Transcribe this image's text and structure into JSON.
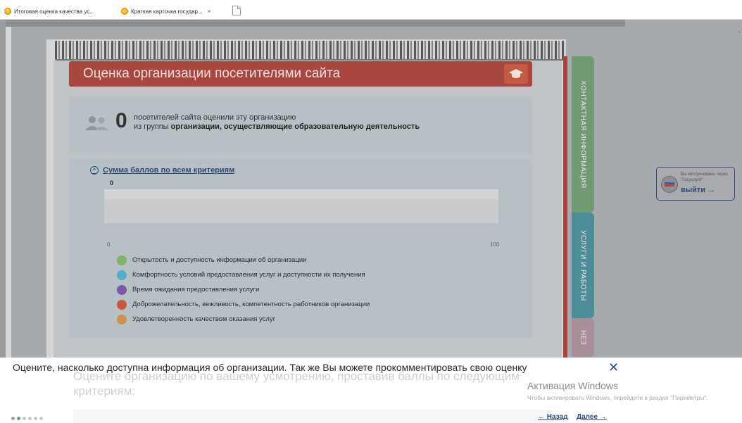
{
  "browser": {
    "tabs": [
      {
        "title": "Итоговая оценка качества ус...",
        "active": false
      },
      {
        "title": "Краткая карточка государ...",
        "active": true,
        "close": "×"
      }
    ]
  },
  "rating": {
    "title": "Оценка организации посетителями сайта",
    "visitor_count": "0",
    "visitor_line1": "посетителей сайта оценили эту организацию",
    "visitor_line2_prefix": "из группы ",
    "visitor_line2_group": "организации, осуществляющие образовательную деятельность",
    "sum_toggle": "Сумма баллов по всем критериям",
    "bar_value": "0",
    "bar_value_fraction": 0,
    "axis_min": "0",
    "axis_max": "100",
    "legend": [
      {
        "label": "Открытость и доступность информации об организации",
        "color": "#7db36a"
      },
      {
        "label": "Комфортность условий предоставления услуг и доступности их получения",
        "color": "#4fb0c6"
      },
      {
        "label": "Время ожидания предоставления услуги",
        "color": "#7a5aa8"
      },
      {
        "label": "Доброжелательность, вежливость, компетентность работников организации",
        "color": "#c9573f"
      },
      {
        "label": "Удовлетворенность качеством оказания услуг",
        "color": "#d38f4d"
      }
    ]
  },
  "side_tabs": {
    "contacts": "КОНТАКТНАЯ ИНФОРМАЦИЯ",
    "services": "УСЛУГИ И РАБОТЫ",
    "other": "НЕЗ"
  },
  "auth": {
    "note": "Вы авторизованы через \"Госуслуги\"",
    "logout": "выйти →"
  },
  "tour": {
    "text": "Оцените, насколько доступна информация об организации. Так же Вы можете прокомментировать свою оценку",
    "ghost": "Оцените организацию по вашему усмотрению, проставив баллы по следующим критериям:",
    "close": "✕",
    "prev": "← Назад",
    "next": "Далее →",
    "step_count": 6,
    "current_step": 2
  },
  "windows_activation": {
    "title": "Активация Windows",
    "note": "Чтобы активировать Windows, перейдите в раздел \"Параметры\"."
  },
  "colors": {
    "title_bar": "#a8473f",
    "accent_blue": "#2d4b7a",
    "green_tab": "#6f9a72",
    "teal_tab": "#4b8e98"
  }
}
